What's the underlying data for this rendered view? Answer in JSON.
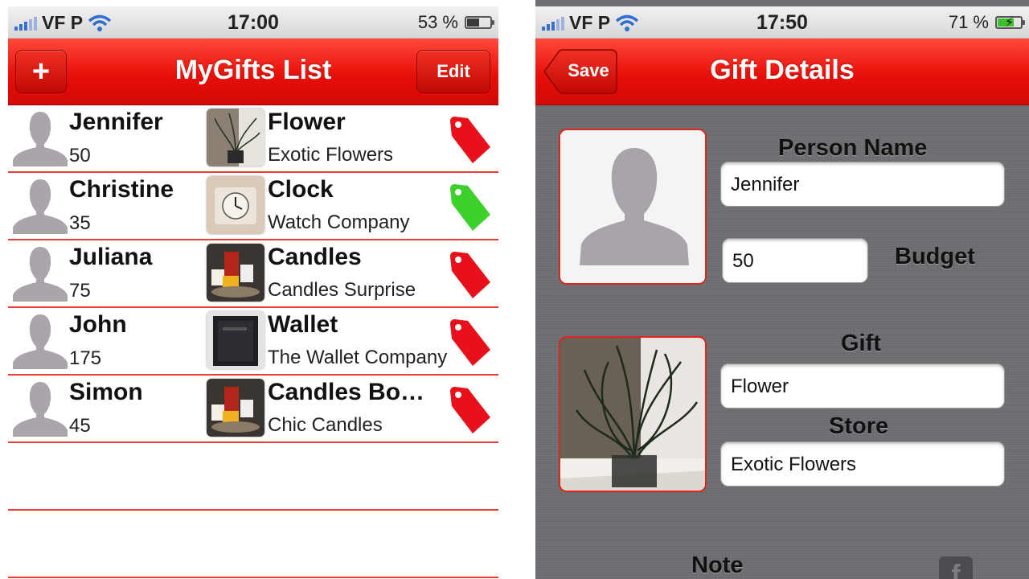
{
  "left_screen": {
    "status": {
      "carrier": "VF P",
      "time": "17:00",
      "battery": "53 %",
      "battery_level": 0.53
    },
    "nav": {
      "title": "MyGifts List",
      "add_label": "+",
      "edit_label": "Edit"
    },
    "rows": [
      {
        "person": "Jennifer",
        "budget": "50",
        "gift": "Flower",
        "store": "Exotic Flowers",
        "tag_color": "#e8101a",
        "thumb": "plant"
      },
      {
        "person": "Christine",
        "budget": "35",
        "gift": "Clock",
        "store": "Watch Company",
        "tag_color": "#3dd02a",
        "thumb": "clock"
      },
      {
        "person": "Juliana",
        "budget": "75",
        "gift": "Candles",
        "store": "Candles Surprise",
        "tag_color": "#e8101a",
        "thumb": "candles"
      },
      {
        "person": "John",
        "budget": "175",
        "gift": "Wallet",
        "store": "The Wallet Company",
        "tag_color": "#e8101a",
        "thumb": "wallet"
      },
      {
        "person": "Simon",
        "budget": "45",
        "gift": "Candles Bo…",
        "store": "Chic Candles",
        "tag_color": "#e8101a",
        "thumb": "candles"
      }
    ]
  },
  "right_screen": {
    "status": {
      "carrier": "VF P",
      "time": "17:50",
      "battery": "71 %",
      "battery_level": 0.71
    },
    "nav": {
      "title": "Gift Details",
      "save_label": "Save"
    },
    "form": {
      "person_name_label": "Person Name",
      "person_name_value": "Jennifer",
      "budget_label": "Budget",
      "budget_value": "50",
      "gift_label": "Gift",
      "gift_value": "Flower",
      "store_label": "Store",
      "store_value": "Exotic Flowers",
      "note_label": "Note"
    },
    "share_icon": "f"
  },
  "colors": {
    "accent_red": "#e80f08",
    "separator": "#ea3b34",
    "tag_red": "#e8101a",
    "tag_green": "#3dd02a"
  }
}
